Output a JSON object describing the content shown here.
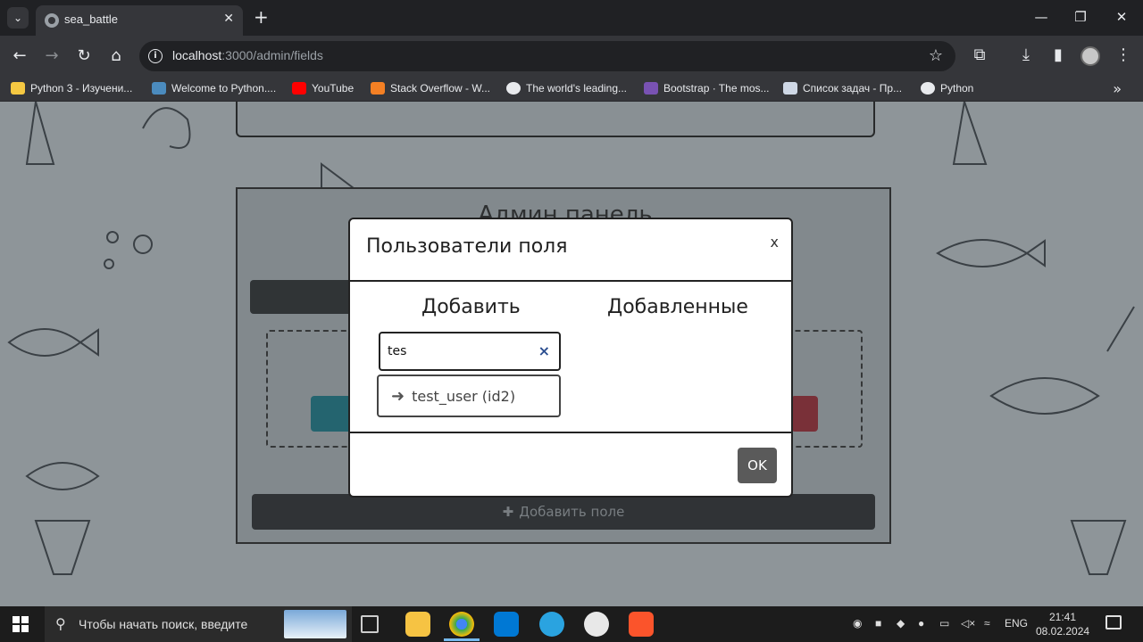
{
  "browser": {
    "tab_title": "sea_battle",
    "url_host": "localhost",
    "url_path": ":3000/admin/fields",
    "bookmarks": [
      "Python 3 - Изучени...",
      "Welcome to Python....",
      "YouTube",
      "Stack Overflow - W...",
      "The world's leading...",
      "Bootstrap · The mos...",
      "Список задач - Пр...",
      "Python"
    ]
  },
  "page": {
    "admin_title": "Админ панель",
    "add_field_label": "Добавить поле"
  },
  "modal": {
    "title": "Пользователи поля",
    "close_label": "x",
    "add_heading": "Добавить",
    "added_heading": "Добавленные",
    "search_value": "tes",
    "clear_label": "×",
    "suggestion_label": "test_user (id2)",
    "ok_label": "OK"
  },
  "taskbar": {
    "search_placeholder": "Чтобы начать поиск, введите",
    "lang": "ENG",
    "time": "21:41",
    "date": "08.02.2024"
  }
}
